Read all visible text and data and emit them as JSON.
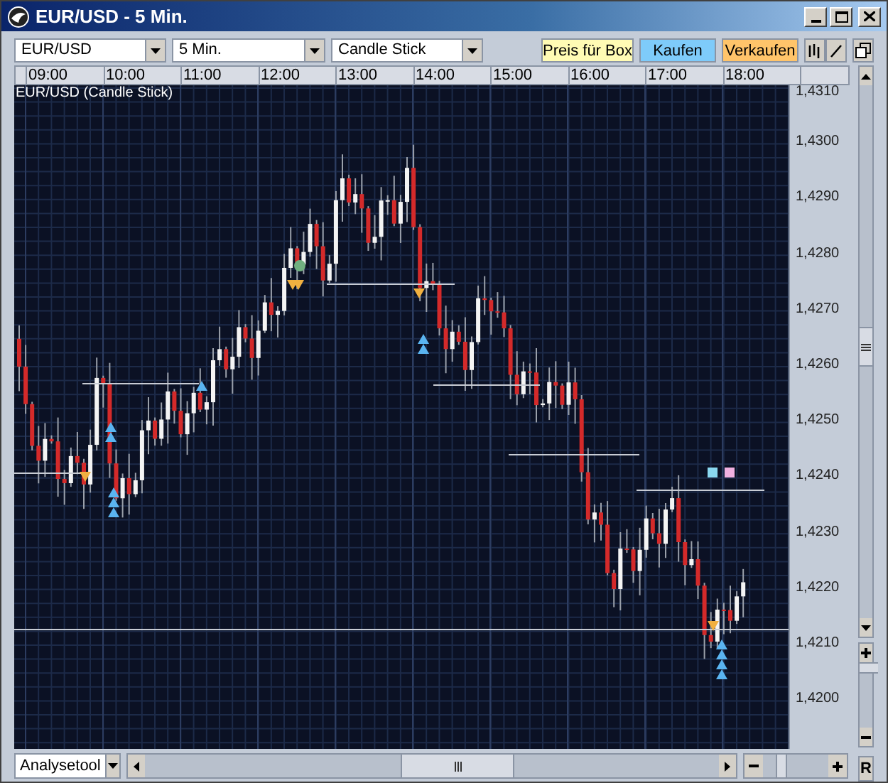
{
  "window": {
    "title": "EUR/USD - 5 Min."
  },
  "toolbar": {
    "selects": [
      {
        "value": "EUR/USD"
      },
      {
        "value": "5 Min."
      },
      {
        "value": "Candle Stick"
      }
    ],
    "buttons": [
      {
        "label": "Preis für Box",
        "kind": "box"
      },
      {
        "label": "Kaufen",
        "kind": "buy"
      },
      {
        "label": "Verkaufen",
        "kind": "sell"
      }
    ]
  },
  "time_axis": [
    "09:00",
    "10:00",
    "11:00",
    "12:00",
    "13:00",
    "14:00",
    "15:00",
    "16:00",
    "17:00",
    "18:00"
  ],
  "chart": {
    "title": "EUR/USD (Candle Stick)",
    "price_axis": [
      "1,4310",
      "1,4300",
      "1,4290",
      "1,4280",
      "1,4270",
      "1,4260",
      "1,4250",
      "1,4240",
      "1,4230",
      "1,4220",
      "1,4210",
      "1,4200"
    ]
  },
  "bottom_bar": {
    "tool": "Analysetool",
    "reset": "R"
  }
}
